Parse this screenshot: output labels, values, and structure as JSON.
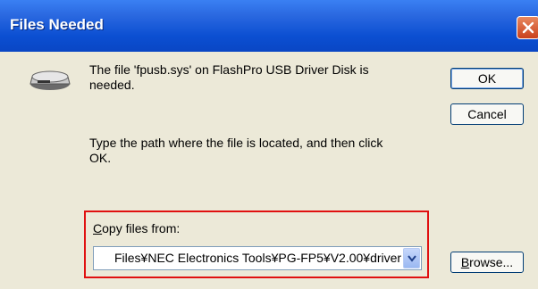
{
  "window": {
    "title": "Files Needed"
  },
  "icons": {
    "close": "close-icon",
    "disk": "disk-drive-icon",
    "dropdown": "chevron-down-icon"
  },
  "message": {
    "line1": "The file 'fpusb.sys' on FlashPro USB Driver Disk is",
    "line2": "needed.",
    "instruction1": "Type the path where the file is located, and then click",
    "instruction2": "OK."
  },
  "buttons": {
    "ok": "OK",
    "cancel": "Cancel",
    "browse_prefix": "B",
    "browse_rest": "rowse..."
  },
  "copy_from": {
    "label_prefix": "C",
    "label_rest": "opy files from:",
    "value": "Files¥NEC Electronics Tools¥PG-FP5¥V2.00¥driver"
  },
  "colors": {
    "titlebar": "#0b4fd2",
    "dialog_bg": "#ece9d8",
    "highlight_border": "#e01010"
  }
}
